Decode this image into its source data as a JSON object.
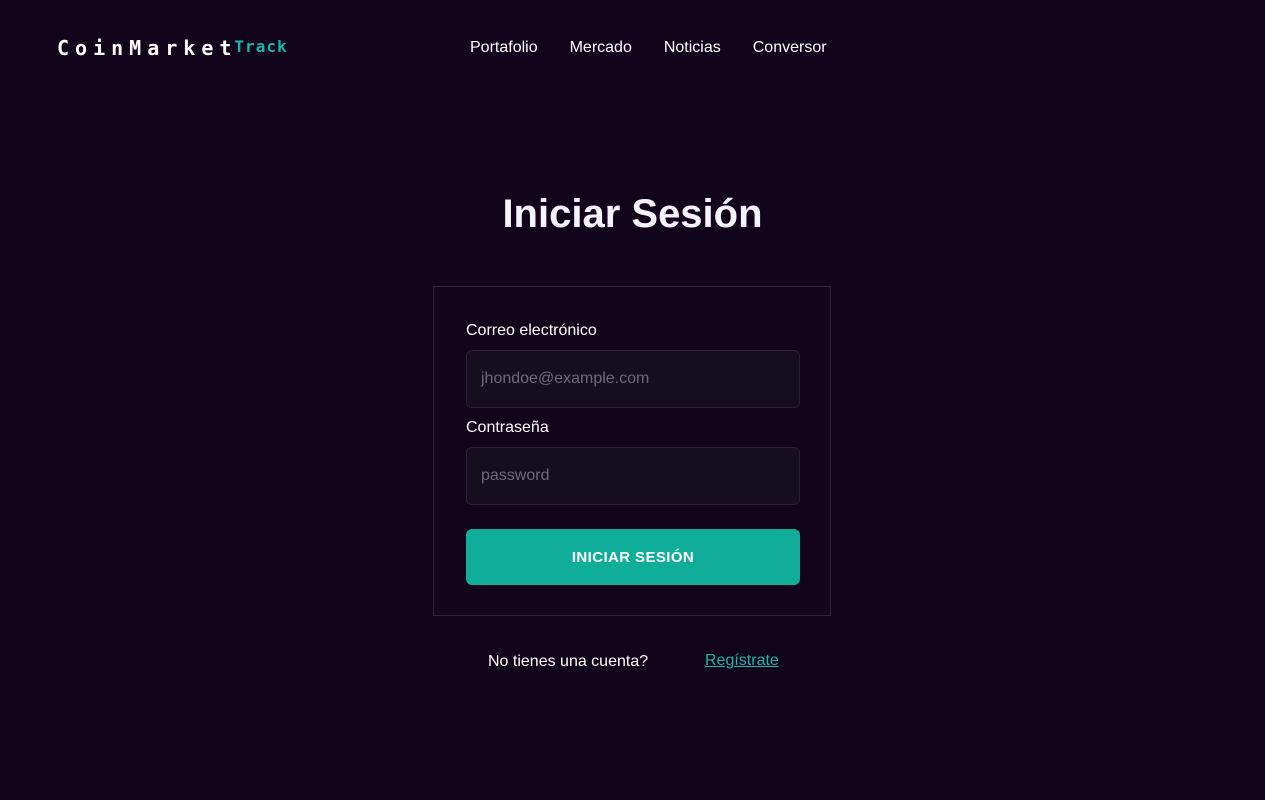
{
  "header": {
    "logo_main": "CoinMarket",
    "logo_accent": "Track",
    "nav": [
      {
        "label": "Portafolio"
      },
      {
        "label": "Mercado"
      },
      {
        "label": "Noticias"
      },
      {
        "label": "Conversor"
      }
    ]
  },
  "login": {
    "title": "Iniciar Sesión",
    "email_label": "Correo electrónico",
    "email_placeholder": "jhondoe@example.com",
    "email_value": "",
    "password_label": "Contraseña",
    "password_placeholder": "password",
    "password_value": "",
    "submit_label": "INICIAR SESIÓN"
  },
  "footer": {
    "prompt": "No tienes una cuenta?",
    "register_label": "Regístrate"
  },
  "colors": {
    "background": "#11041b",
    "accent": "#14b8a6",
    "button": "#10ae98"
  }
}
